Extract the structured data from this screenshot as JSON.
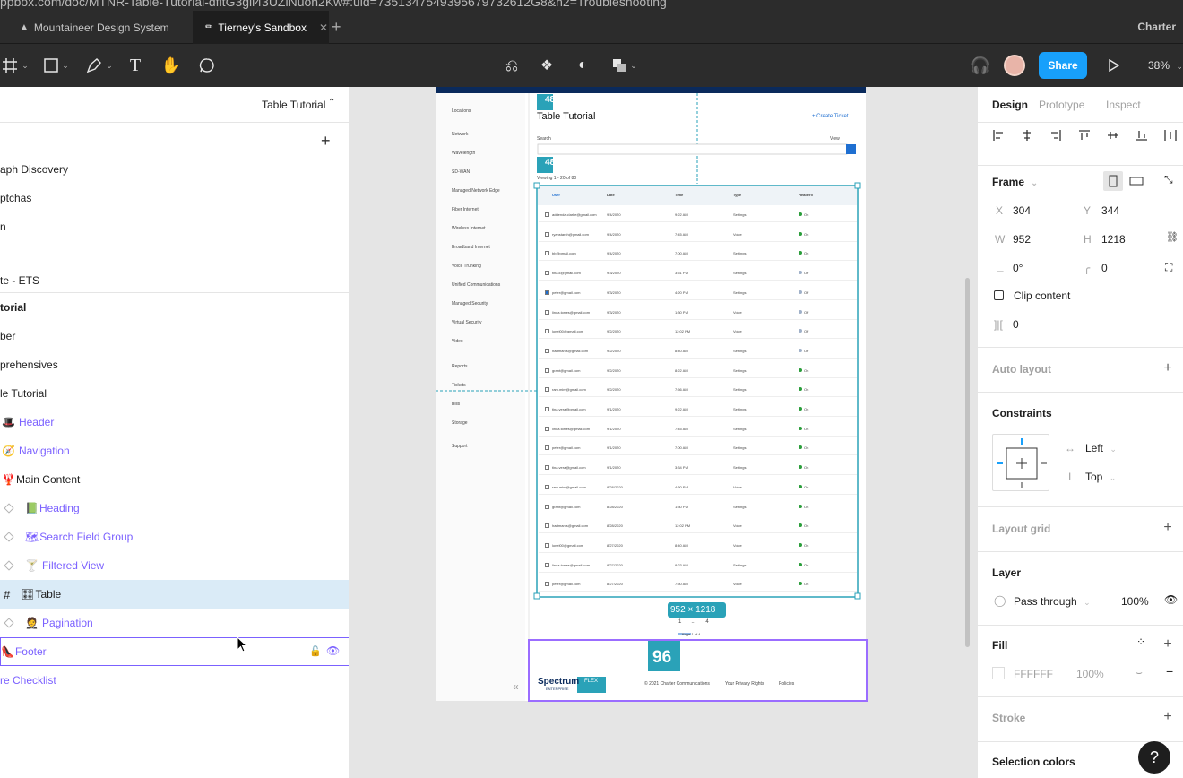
{
  "browser": {
    "url": "ppbox.com/doc/MTNR-Table-Tutorial-dfltG3gll43UZiNuon2Kw#:uid=7351347549395679732612G8&h2=Troubleshooting"
  },
  "tabs": [
    {
      "label": "Mountaineer Design System"
    },
    {
      "label": "Tierney's Sandbox"
    }
  ],
  "org_name": "Charter",
  "toolbar": {
    "share_label": "Share",
    "zoom": "38%"
  },
  "layers_panel": {
    "page_title": "Table Tutorial",
    "pages": [
      "aph Discovery",
      "ptchas",
      "n",
      "te - ETS"
    ],
    "layers": [
      {
        "label": "torial"
      },
      {
        "label": "ber"
      },
      {
        "label": "prehensives"
      },
      {
        "label": "le Tutorial"
      },
      {
        "icon": "🎩",
        "label": "Header"
      },
      {
        "icon": "🧭",
        "label": "Navigation"
      },
      {
        "icon": "🦞",
        "label": "Main Content"
      },
      {
        "icon": "📗",
        "label": "Heading"
      },
      {
        "icon": "🗺",
        "label": "Search Field Group"
      },
      {
        "icon": "🍸",
        "label": "Filtered View"
      },
      {
        "icon": "🎛",
        "label": "Table"
      },
      {
        "icon": "🤵",
        "label": "Pagination"
      },
      {
        "icon": "👠",
        "label": "Footer"
      },
      {
        "label": "re Checklist"
      }
    ]
  },
  "canvas": {
    "page_heading": "Table Tutorial",
    "create_ticket": "+ Create Ticket",
    "search_label": "Search",
    "view_label": "View",
    "viewing": "Viewing 1 - 20 of 80",
    "badge_48a": "48",
    "badge_48b": "48",
    "badge_96": "96",
    "size_label": "952 × 1218",
    "footer_text": "© 2021 Charter Communications",
    "privacy": "Your Privacy Rights",
    "policies": "Policies",
    "brand": "Spectrum",
    "brand_sub": "ENTERPRISE",
    "flex_label": "FLEX",
    "page_of": "Page 1 of 4",
    "pager": [
      "1",
      "...",
      "4"
    ],
    "nav_items": [
      "Locations",
      "Network",
      "Wavelength",
      "SD-WAN",
      "Managed Network Edge",
      "Fiber Internet",
      "Wireless Internet",
      "Broadband Internet",
      "Voice Trunking",
      "Unified Communications",
      "Managed Security",
      "Virtual Security",
      "Video",
      "Reports",
      "Tickets",
      "Bills",
      "Storage",
      "Support"
    ],
    "table_headers": [
      "User",
      "Date",
      "Time",
      "Type",
      "Header5"
    ],
    "table_rows": [
      [
        "adrienda.clarke@gmail.com",
        "9/4/2020",
        "9:22 AM",
        "Settings",
        "On"
      ],
      [
        "ryanstarch@gmail.com",
        "9/4/2020",
        "7:45 AM",
        "Voice",
        "On"
      ],
      [
        "bb@gmail.com",
        "9/4/2020",
        "7:00 AM",
        "Settings",
        "On"
      ],
      [
        "tina.k@gmail.com",
        "9/3/2020",
        "3:51 PM",
        "Settings",
        "Off"
      ],
      [
        "peter@gmail.com",
        "9/3/2020",
        "4:20 PM",
        "Settings",
        "Off"
      ],
      [
        "linda.torres@gmail.com",
        "9/3/2020",
        "1:30 PM",
        "Voice",
        "Off"
      ],
      [
        "lonel00@gmail.com",
        "9/2/2020",
        "12:02 PM",
        "Voice",
        "Off"
      ],
      [
        "hartman.s@gmail.com",
        "9/2/2020",
        "8:40 AM",
        "Settings",
        "Off"
      ],
      [
        "grant@gmail.com",
        "9/2/2020",
        "8:22 AM",
        "Settings",
        "On"
      ],
      [
        "ram.mim@gmail.com",
        "9/2/2020",
        "7:56 AM",
        "Settings",
        "On"
      ],
      [
        "tina.vera@gmail.com",
        "9/1/2020",
        "9:22 AM",
        "Settings",
        "On"
      ],
      [
        "linda.torres@gmail.com",
        "9/1/2020",
        "7:45 AM",
        "Settings",
        "On"
      ],
      [
        "peter@gmail.com",
        "9/1/2020",
        "7:00 AM",
        "Settings",
        "On"
      ],
      [
        "tina.vera@gmail.com",
        "9/1/2020",
        "3:34 PM",
        "Settings",
        "On"
      ],
      [
        "ram.mim@gmail.com",
        "8/28/2020",
        "4:30 PM",
        "Voice",
        "On"
      ],
      [
        "grant@gmail.com",
        "8/28/2020",
        "1:30 PM",
        "Settings",
        "On"
      ],
      [
        "hartman.s@gmail.com",
        "8/28/2020",
        "12:02 PM",
        "Voice",
        "On"
      ],
      [
        "lonel00@gmail.com",
        "8/27/2020",
        "8:40 AM",
        "Voice",
        "On"
      ],
      [
        "linda.torres@gmail.com",
        "8/27/2020",
        "8:23 AM",
        "Settings",
        "On"
      ],
      [
        "peter@gmail.com",
        "8/27/2020",
        "7:50 AM",
        "Voice",
        "On"
      ]
    ]
  },
  "design_panel": {
    "tabs": [
      "Design",
      "Prototype",
      "Inspect"
    ],
    "frame_label": "Frame",
    "x_label": "X",
    "x": "304",
    "y_label": "Y",
    "y": "344",
    "w_label": "W",
    "w": "952",
    "h_label": "H",
    "h": "1218",
    "rotation": "0°",
    "radius": "0",
    "clip_content": "Clip content",
    "spacing": "0",
    "auto_layout": "Auto layout",
    "constraints": "Constraints",
    "constraint_h": "Left",
    "constraint_v": "Top",
    "layout_grid": "Layout grid",
    "layer": "Layer",
    "blend": "Pass through",
    "opacity": "100%",
    "fill": "Fill",
    "fill_hex": "FFFFFF",
    "fill_opacity": "100%",
    "stroke": "Stroke",
    "selection_colors": "Selection colors"
  },
  "colors": {
    "accent": "#18a0fb",
    "selection": "#7b61ff",
    "teal": "#2aa2b8",
    "navy": "#0a2a5c"
  }
}
